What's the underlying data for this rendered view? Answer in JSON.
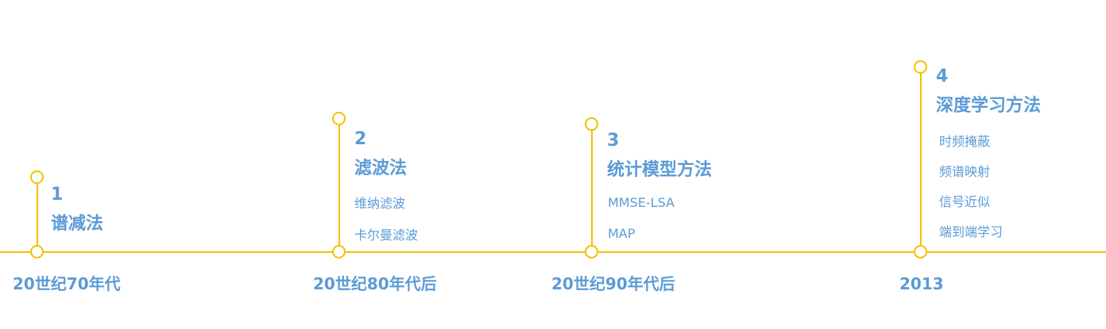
{
  "colors": {
    "line": "#f5c000",
    "text": "#5b9bd5"
  },
  "stages": [
    {
      "number": "1",
      "title": "谱减法",
      "items": [],
      "era": "20世纪70年代"
    },
    {
      "number": "2",
      "title": "滤波法",
      "items": [
        "维纳滤波",
        "卡尔曼滤波"
      ],
      "era": "20世纪80年代后"
    },
    {
      "number": "3",
      "title": "统计模型方法",
      "items": [
        "MMSE-LSA",
        "MAP"
      ],
      "era": "20世纪90年代后"
    },
    {
      "number": "4",
      "title": "深度学习方法",
      "items": [
        "时频掩蔽",
        "频谱映射",
        "信号近似",
        "端到端学习"
      ],
      "era": "2013"
    }
  ]
}
